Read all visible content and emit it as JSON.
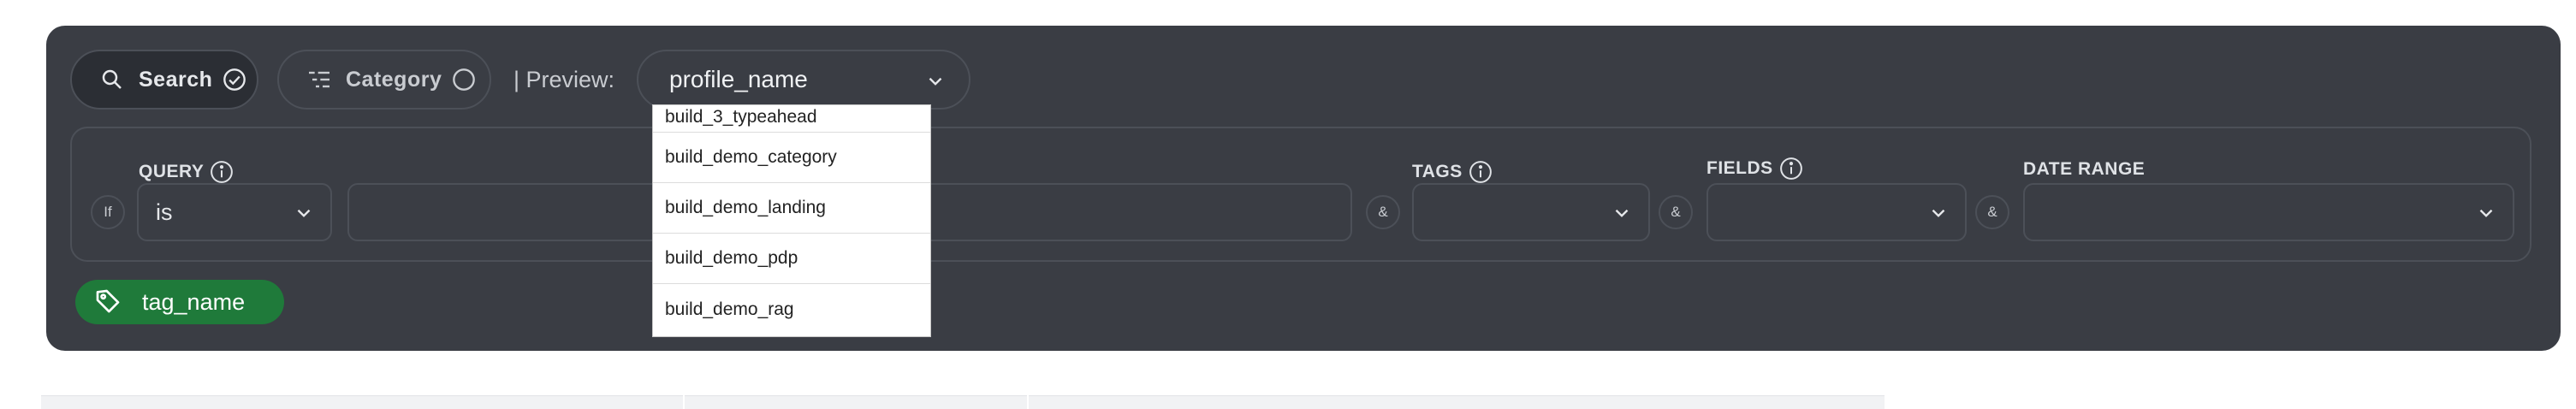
{
  "toolbar": {
    "search_label": "Search",
    "category_label": "Category",
    "preview_label": "| Preview:",
    "preview_value": "profile_name"
  },
  "query": {
    "query_label": "QUERY",
    "tags_label": "TAGS",
    "fields_label": "FIELDS",
    "date_range_label": "DATE RANGE",
    "if_label": "If",
    "operator_value": "is",
    "amp": "&"
  },
  "tag_chip": {
    "label": "tag_name"
  },
  "dropdown": {
    "options": [
      "build_3_typeahead",
      "build_demo_category",
      "build_demo_landing",
      "build_demo_pdp",
      "build_demo_rag"
    ]
  },
  "colors": {
    "panel": "#3a3d44",
    "tag_green": "#1f7a3a",
    "border": "#4c5058"
  }
}
